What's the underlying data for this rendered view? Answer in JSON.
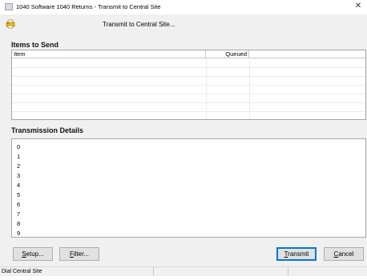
{
  "window": {
    "title": "1040 Software 1040 Returns - Transmit to Central Site",
    "close_glyph": "✕"
  },
  "header": {
    "icon": "printer-icon",
    "text": "Transmit to Central Site..."
  },
  "items_section": {
    "label": "Items to Send",
    "columns": [
      "Item",
      "Queued"
    ]
  },
  "details_section": {
    "label": "Transmission Details",
    "lines": [
      "0",
      "1",
      "2",
      "3",
      "4",
      "5",
      "6",
      "7",
      "8",
      "9"
    ]
  },
  "buttons": {
    "setup": {
      "accel": "S",
      "rest": "etup..."
    },
    "filter": {
      "accel": "F",
      "rest": "ilter..."
    },
    "transmit": {
      "accel": "T",
      "rest": "ransmit"
    },
    "cancel": {
      "accel": "C",
      "rest": "ancel"
    }
  },
  "status": {
    "text": "Dial Central Site"
  },
  "colors": {
    "accent": "#0078d7",
    "icon_yellow": "#f2c200",
    "icon_red": "#d23b2b"
  }
}
